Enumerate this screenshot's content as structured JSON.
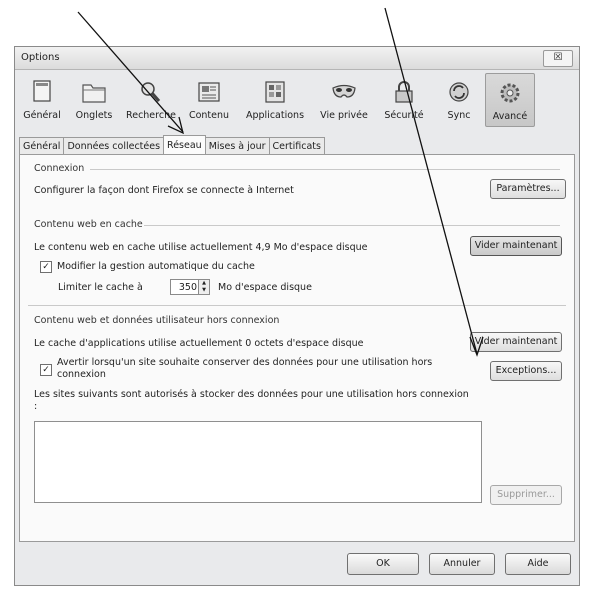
{
  "window": {
    "title": "Options",
    "close_label": "☒"
  },
  "toolbar": [
    {
      "label": "Général",
      "icon": "general-window-icon"
    },
    {
      "label": "Onglets",
      "icon": "tabs-folder-icon"
    },
    {
      "label": "Recherche",
      "icon": "magnifier-icon"
    },
    {
      "label": "Contenu",
      "icon": "content-page-icon"
    },
    {
      "label": "Applications",
      "icon": "applications-icon"
    },
    {
      "label": "Vie privée",
      "icon": "mask-icon"
    },
    {
      "label": "Sécurité",
      "icon": "padlock-icon"
    },
    {
      "label": "Sync",
      "icon": "sync-icon"
    },
    {
      "label": "Avancé",
      "icon": "gear-icon",
      "selected": true
    }
  ],
  "tabs": [
    {
      "label": "Général"
    },
    {
      "label": "Données collectées"
    },
    {
      "label": "Réseau",
      "active": true
    },
    {
      "label": "Mises à jour"
    },
    {
      "label": "Certificats"
    }
  ],
  "connexion": {
    "title": "Connexion",
    "description": "Configurer la façon dont Firefox se connecte à Internet",
    "settings_button": "Paramètres..."
  },
  "cache": {
    "title": "Contenu web en cache",
    "usage_text": "Le contenu web en cache utilise actuellement 4,9 Mo d'espace disque",
    "clear_button": "Vider maintenant",
    "override_label": "Modifier la gestion automatique du cache",
    "override_checked": true,
    "limit_label": "Limiter le cache à",
    "limit_value": "350",
    "limit_unit": "Mo d'espace disque"
  },
  "offline": {
    "title": "Contenu web et données utilisateur hors connexion",
    "usage_text": "Le cache d'applications utilise actuellement 0 octets d'espace disque",
    "clear_button": "Vider maintenant",
    "notify_label": "Avertir lorsqu'un site souhaite conserver des données pour une utilisation hors connexion",
    "notify_checked": true,
    "exceptions_button": "Exceptions...",
    "sites_label": "Les sites suivants sont autorisés à stocker des données pour une utilisation hors connexion :",
    "remove_button": "Supprimer..."
  },
  "footer": {
    "ok": "OK",
    "cancel": "Annuler",
    "help": "Aide"
  }
}
